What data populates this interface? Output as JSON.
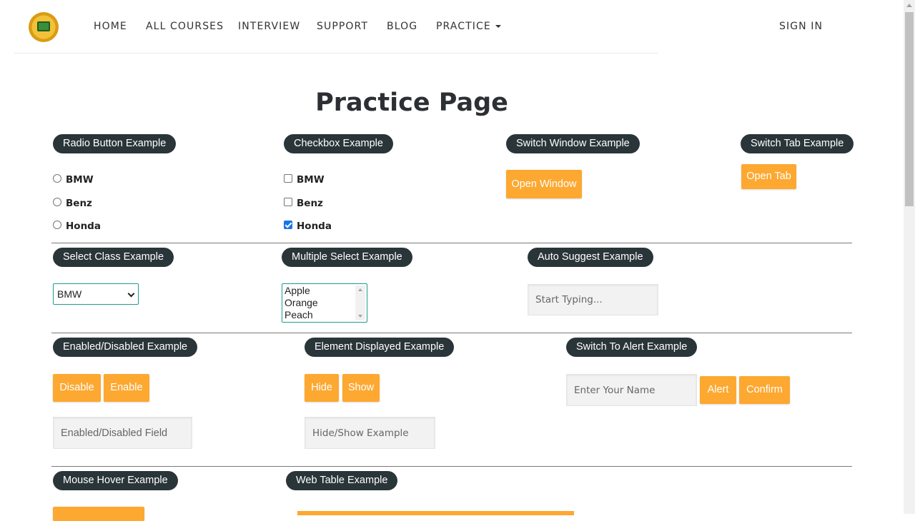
{
  "nav": {
    "items": [
      "HOME",
      "ALL COURSES",
      "INTERVIEW",
      "SUPPORT",
      "BLOG",
      "PRACTICE"
    ],
    "sign_in": "SIGN IN"
  },
  "page_title": "Practice Page",
  "radio": {
    "legend": "Radio Button Example",
    "options": [
      "BMW",
      "Benz",
      "Honda"
    ]
  },
  "checkbox": {
    "legend": "Checkbox Example",
    "options": [
      "BMW",
      "Benz",
      "Honda"
    ],
    "checked": [
      false,
      false,
      true
    ]
  },
  "switch_window": {
    "legend": "Switch Window Example",
    "button": "Open Window"
  },
  "switch_tab": {
    "legend": "Switch Tab Example",
    "button": "Open Tab"
  },
  "select_class": {
    "legend": "Select Class Example",
    "selected": "BMW"
  },
  "multi_select": {
    "legend": "Multiple Select Example",
    "options": [
      "Apple",
      "Orange",
      "Peach"
    ]
  },
  "auto_suggest": {
    "legend": "Auto Suggest Example",
    "placeholder": "Start Typing..."
  },
  "enabled_disabled": {
    "legend": "Enabled/Disabled Example",
    "disable": "Disable",
    "enable": "Enable",
    "field_placeholder": "Enabled/Disabled Field"
  },
  "element_displayed": {
    "legend": "Element Displayed Example",
    "hide": "Hide",
    "show": "Show",
    "field_placeholder": "Hide/Show Example"
  },
  "alert": {
    "legend": "Switch To Alert Example",
    "name_placeholder": "Enter Your Name",
    "alert": "Alert",
    "confirm": "Confirm"
  },
  "mouse_hover": {
    "legend": "Mouse Hover Example"
  },
  "web_table": {
    "legend": "Web Table Example"
  },
  "colors": {
    "accent": "#fda831",
    "legend_bg": "#2a3539",
    "border_teal": "#1d9c8f"
  },
  "icons": {
    "logo": "logo-icon",
    "dropdown": "caret-down-icon"
  }
}
